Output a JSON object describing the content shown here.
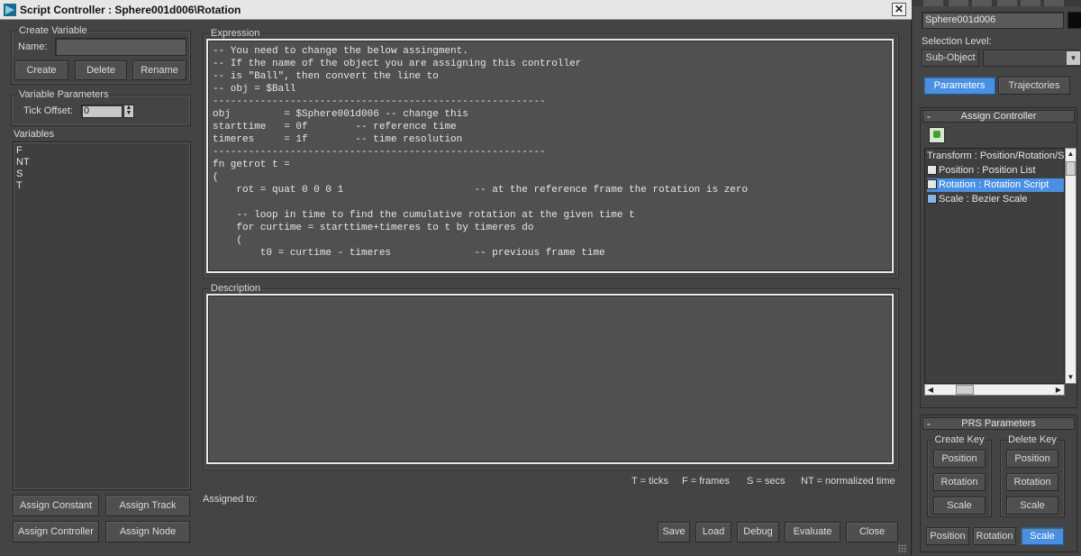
{
  "window": {
    "title": "Script Controller : Sphere001d006\\Rotation",
    "close_label": "✕"
  },
  "create_variable": {
    "group_label": "Create Variable",
    "name_label": "Name:",
    "name_value": "",
    "create_label": "Create",
    "delete_label": "Delete",
    "rename_label": "Rename"
  },
  "variable_parameters": {
    "group_label": "Variable Parameters",
    "tick_offset_label": "Tick Offset:",
    "tick_offset_value": "0"
  },
  "variables": {
    "label": "Variables",
    "items": [
      "F",
      "NT",
      "S",
      "T"
    ]
  },
  "assign_buttons": {
    "constant": "Assign Constant",
    "track": "Assign Track",
    "controller": "Assign Controller",
    "node": "Assign Node"
  },
  "expression": {
    "label": "Expression",
    "code": "-- You need to change the below assingment.\n-- If the name of the object you are assigning this controller\n-- is \"Ball\", then convert the line to\n-- obj = $Ball\n--------------------------------------------------------\nobj         = $Sphere001d006 -- change this\nstarttime   = 0f        -- reference time\ntimeres     = 1f        -- time resolution\n--------------------------------------------------------\nfn getrot t =\n(\n    rot = quat 0 0 0 1                      -- at the reference frame the rotation is zero\n\n    -- loop in time to find the cumulative rotation at the given time t\n    for curtime = starttime+timeres to t by timeres do\n    (\n        t0 = curtime - timeres              -- previous frame time"
  },
  "description": {
    "label": "Description",
    "text": ""
  },
  "legend": {
    "ticks": "T = ticks",
    "frames": "F = frames",
    "secs": "S = secs",
    "nt": "NT = normalized time"
  },
  "assigned_to_label": "Assigned to:",
  "bottom_buttons": {
    "save": "Save",
    "load": "Load",
    "debug": "Debug",
    "evaluate": "Evaluate",
    "close": "Close"
  },
  "panel": {
    "object_name": "Sphere001d006",
    "selection_level_label": "Selection Level:",
    "sub_object_label": "Sub-Object",
    "tabs": {
      "parameters": "Parameters",
      "trajectories": "Trajectories"
    },
    "assign_controller": {
      "title": "Assign Controller",
      "minus": "-",
      "tree": [
        "Transform : Position/Rotation/Scale",
        "Position : Position List",
        "Rotation : Rotation Script",
        "Scale : Bezier Scale"
      ]
    },
    "prs": {
      "title": "PRS Parameters",
      "minus": "-",
      "create_key_label": "Create Key",
      "delete_key_label": "Delete Key",
      "position": "Position",
      "rotation": "Rotation",
      "scale": "Scale"
    }
  },
  "colors": {
    "accent": "#4a90e2",
    "object_color": "#0a0a0a"
  }
}
